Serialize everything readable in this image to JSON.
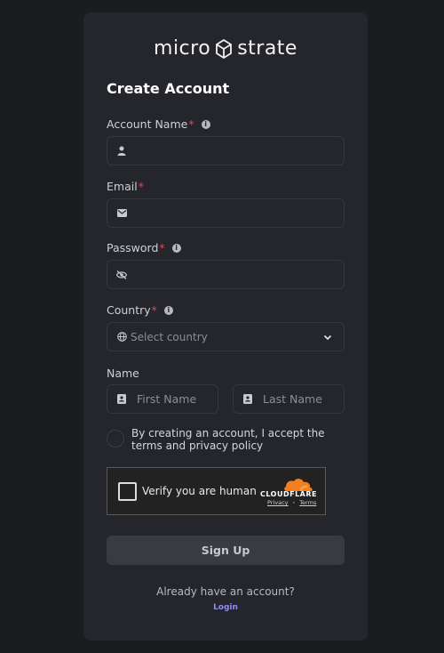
{
  "brand": {
    "left": "micro",
    "right": "strate"
  },
  "form": {
    "title": "Create Account",
    "account_name": {
      "label": "Account Name",
      "required": "*",
      "value": "",
      "placeholder": ""
    },
    "email": {
      "label": "Email",
      "required": "*",
      "value": "",
      "placeholder": ""
    },
    "password": {
      "label": "Password",
      "required": "*",
      "value": "",
      "placeholder": ""
    },
    "country": {
      "label": "Country",
      "required": "*",
      "selected": "Select country"
    },
    "name": {
      "label": "Name",
      "first_placeholder": "First Name",
      "last_placeholder": "Last Name"
    },
    "terms": "By creating an account, I accept the terms and privacy policy",
    "signup_label": "Sign Up",
    "already": "Already have an account?",
    "login_label": "Login"
  },
  "captcha": {
    "label": "Verify you are human",
    "provider": "CLOUDFLARE",
    "privacy": "Privacy",
    "separator": "·",
    "terms": "Terms"
  },
  "colors": {
    "background": "#1b1c20",
    "card": "#25262b",
    "required": "#e5484d",
    "link": "#8e8cf0",
    "button": "#393a42",
    "cloudflare": "#f38020"
  },
  "icons": [
    "logo-mark-icon",
    "info-icon",
    "user-icon",
    "mail-icon",
    "eye-off-icon",
    "globe-icon",
    "chevron-down-icon",
    "id-card-icon",
    "cloud-icon"
  ]
}
